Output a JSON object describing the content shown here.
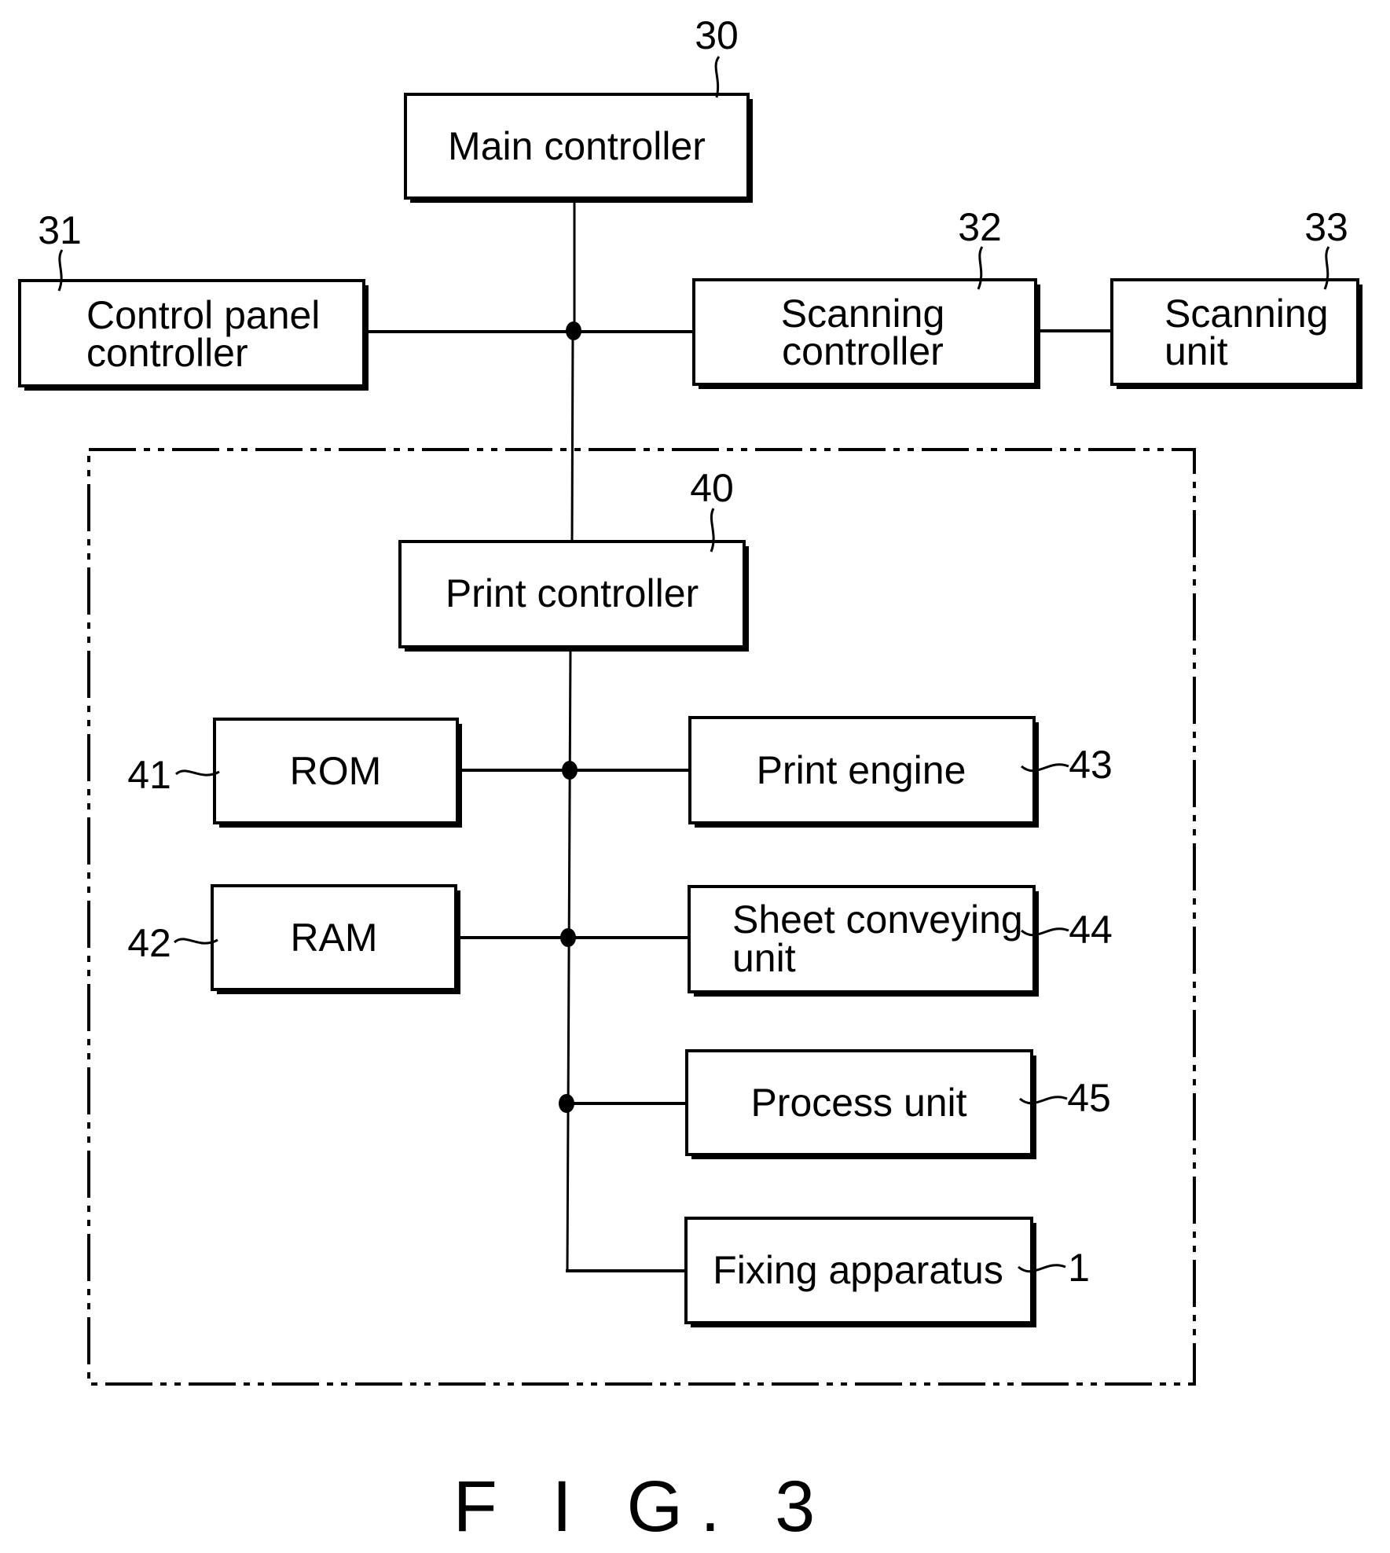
{
  "figure": {
    "caption": "F I G. 3",
    "blocks": {
      "main_controller": {
        "ref": "30",
        "lines": [
          "Main controller"
        ]
      },
      "control_panel_controller": {
        "ref": "31",
        "lines": [
          "Control panel",
          "controller"
        ]
      },
      "scanning_controller": {
        "ref": "32",
        "lines": [
          "Scanning",
          "controller"
        ]
      },
      "scanning_unit": {
        "ref": "33",
        "lines": [
          "Scanning",
          "unit"
        ]
      },
      "print_controller": {
        "ref": "40",
        "lines": [
          "Print controller"
        ]
      },
      "rom": {
        "ref": "41",
        "lines": [
          "ROM"
        ]
      },
      "ram": {
        "ref": "42",
        "lines": [
          "RAM"
        ]
      },
      "print_engine": {
        "ref": "43",
        "lines": [
          "Print engine"
        ]
      },
      "sheet_conveying_unit": {
        "ref": "44",
        "lines": [
          "Sheet conveying",
          "unit"
        ]
      },
      "process_unit": {
        "ref": "45",
        "lines": [
          "Process unit"
        ]
      },
      "fixing_apparatus": {
        "ref": "1",
        "lines": [
          "Fixing apparatus"
        ]
      }
    },
    "connections": [
      [
        "main_controller",
        "bus_upper"
      ],
      [
        "control_panel_controller",
        "bus_upper"
      ],
      [
        "scanning_controller",
        "bus_upper"
      ],
      [
        "scanning_controller",
        "scanning_unit"
      ],
      [
        "bus_upper",
        "print_controller"
      ],
      [
        "print_controller",
        "bus_lower"
      ],
      [
        "rom",
        "bus_lower"
      ],
      [
        "ram",
        "bus_lower"
      ],
      [
        "print_engine",
        "bus_lower"
      ],
      [
        "sheet_conveying_unit",
        "bus_lower"
      ],
      [
        "process_unit",
        "bus_lower"
      ],
      [
        "fixing_apparatus",
        "bus_lower"
      ]
    ],
    "group": {
      "name": "print section",
      "contains": [
        "print_controller",
        "rom",
        "ram",
        "print_engine",
        "sheet_conveying_unit",
        "process_unit",
        "fixing_apparatus"
      ]
    }
  }
}
